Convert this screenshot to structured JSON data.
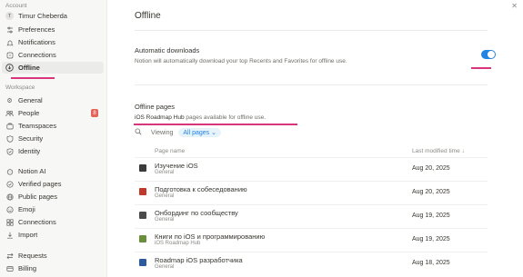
{
  "colors": {
    "accent": "#2383e2",
    "annotation": "#d9357a",
    "badge": "#e56458"
  },
  "sidebar": {
    "account_heading": "Account",
    "user": {
      "avatar": "T",
      "name": "Timur Cheberda"
    },
    "account_items": [
      {
        "icon": "sliders-icon",
        "label": "Preferences"
      },
      {
        "icon": "bell-icon",
        "label": "Notifications"
      },
      {
        "icon": "link-icon",
        "label": "Connections"
      },
      {
        "icon": "download-icon",
        "label": "Offline",
        "active": true
      }
    ],
    "workspace_heading": "Workspace",
    "workspace_items": [
      {
        "icon": "gear-icon",
        "label": "General"
      },
      {
        "icon": "people-icon",
        "label": "People",
        "badge": "8"
      },
      {
        "icon": "teamspaces-icon",
        "label": "Teamspaces"
      },
      {
        "icon": "shield-icon",
        "label": "Security"
      },
      {
        "icon": "identity-icon",
        "label": "Identity"
      },
      {
        "icon": "notion-ai-icon",
        "label": "Notion AI"
      },
      {
        "icon": "verified-icon",
        "label": "Verified pages"
      },
      {
        "icon": "globe-icon",
        "label": "Public pages"
      },
      {
        "icon": "emoji-icon",
        "label": "Emoji"
      },
      {
        "icon": "connections-icon",
        "label": "Connections"
      },
      {
        "icon": "import-icon",
        "label": "Import"
      },
      {
        "icon": "requests-icon",
        "label": "Requests"
      },
      {
        "icon": "billing-icon",
        "label": "Billing"
      }
    ]
  },
  "main": {
    "title": "Offline",
    "auto": {
      "title": "Automatic downloads",
      "desc": "Notion will automatically download your top Recents and Favorites for offline use.",
      "enabled": true
    },
    "offline_pages": {
      "title": "Offline pages",
      "workspace": "iOS Roadmap Hub",
      "desc_rest": " pages available for offline use.",
      "viewing_label": "Viewing",
      "filter": "All pages",
      "col_name": "Page name",
      "col_date": "Last modified time ↓"
    },
    "rows": [
      {
        "icon": "graduation-cap-icon",
        "color": "#3b3b3b",
        "title": "Изучение iOS",
        "sub": "General",
        "date": "Aug 20, 2025"
      },
      {
        "icon": "book-icon",
        "color": "#c0392b",
        "title": "Подготовка к собеседованию",
        "sub": "General",
        "date": "Aug 20, 2025"
      },
      {
        "icon": "community-icon",
        "color": "#4a4a4a",
        "title": "Онбординг по сообществу",
        "sub": "General",
        "date": "Aug 19, 2025"
      },
      {
        "icon": "books-icon",
        "color": "#6a8f3a",
        "title": "Книги по iOS и программированию",
        "sub": "iOS Roadmap Hub",
        "date": "Aug 19, 2025"
      },
      {
        "icon": "map-icon",
        "color": "#2c5aa0",
        "title": "Roadmap iOS разработчика",
        "sub": "General",
        "date": "Aug 18, 2025"
      }
    ]
  }
}
